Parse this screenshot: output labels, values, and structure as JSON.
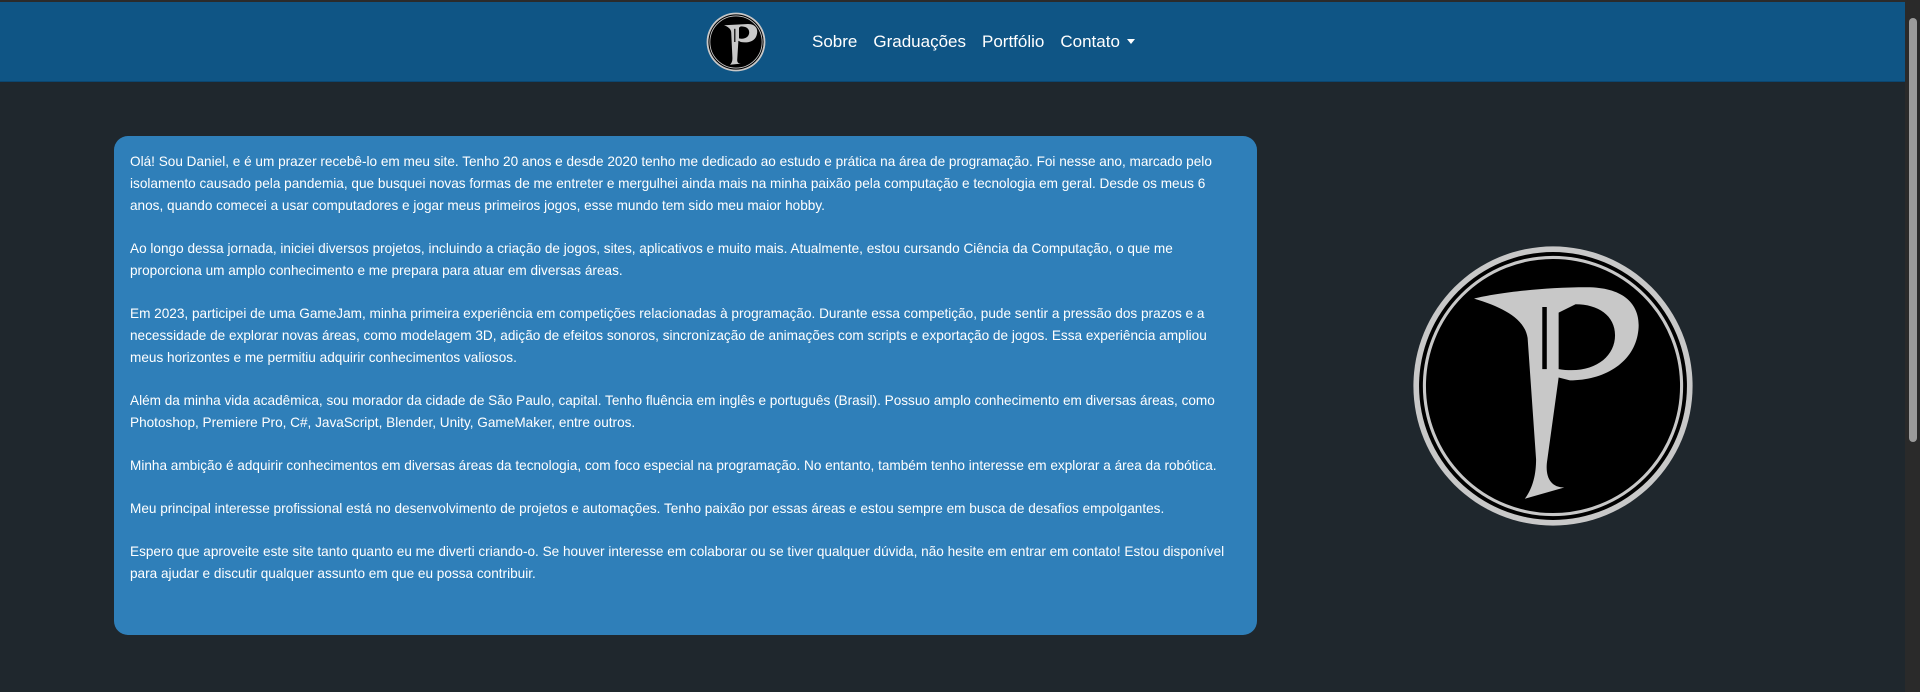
{
  "nav": {
    "logo_icon": "p-logo-icon",
    "items": [
      {
        "label": "Sobre"
      },
      {
        "label": "Graduações"
      },
      {
        "label": "Portfólio"
      },
      {
        "label": "Contato"
      }
    ]
  },
  "logo": {
    "letter": "P",
    "colors": {
      "circle": "#000000",
      "ring": "#c8c8c8",
      "letter": "#c8c8c8"
    }
  },
  "about": {
    "paragraphs": [
      "Olá! Sou Daniel, e é um prazer recebê-lo em meu site. Tenho 20 anos e desde 2020 tenho me dedicado ao estudo e prática na área de programação. Foi nesse ano, marcado pelo isolamento causado pela pandemia, que busquei novas formas de me entreter e mergulhei ainda mais na minha paixão pela computação e tecnologia em geral. Desde os meus 6 anos, quando comecei a usar computadores e jogar meus primeiros jogos, esse mundo tem sido meu maior hobby.",
      "Ao longo dessa jornada, iniciei diversos projetos, incluindo a criação de jogos, sites, aplicativos e muito mais. Atualmente, estou cursando Ciência da Computação, o que me proporciona um amplo conhecimento e me prepara para atuar em diversas áreas.",
      "Em 2023, participei de uma GameJam, minha primeira experiência em competições relacionadas à programação. Durante essa competição, pude sentir a pressão dos prazos e a necessidade de explorar novas áreas, como modelagem 3D, adição de efeitos sonoros, sincronização de animações com scripts e exportação de jogos. Essa experiência ampliou meus horizontes e me permitiu adquirir conhecimentos valiosos.",
      "Além da minha vida acadêmica, sou morador da cidade de São Paulo, capital. Tenho fluência em inglês e português (Brasil). Possuo amplo conhecimento em diversas áreas, como Photoshop, Premiere Pro, C#, JavaScript, Blender, Unity, GameMaker, entre outros.",
      "Minha ambição é adquirir conhecimentos em diversas áreas da tecnologia, com foco especial na programação. No entanto, também tenho interesse em explorar a área da robótica.",
      "Meu principal interesse profissional está no desenvolvimento de projetos e automações. Tenho paixão por essas áreas e estou sempre em busca de desafios empolgantes.",
      "Espero que aproveite este site tanto quanto eu me diverti criando-o. Se houver interesse em colaborar ou se tiver qualquer dúvida, não hesite em entrar em contato! Estou disponível para ajudar e discutir qualquer assunto em que eu possa contribuir."
    ]
  },
  "colors": {
    "navbar": "#0f5585",
    "background": "#1f272d",
    "card": "#2f7fb9"
  }
}
